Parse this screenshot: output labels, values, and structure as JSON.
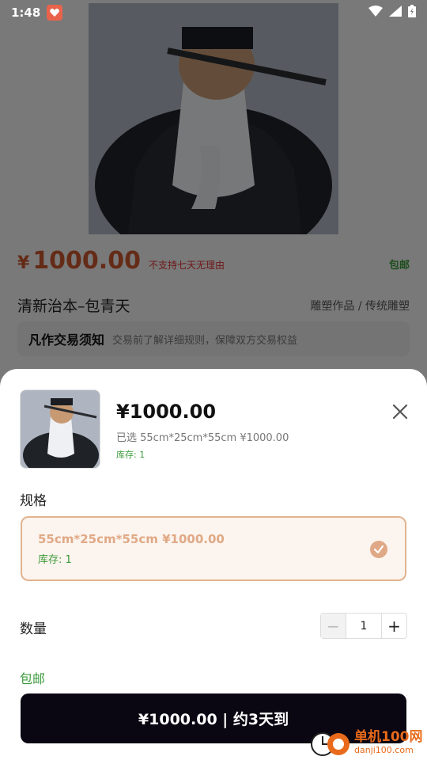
{
  "status_bar": {
    "time": "1:48"
  },
  "product_page": {
    "currency": "¥",
    "price": "1000.00",
    "no_return": "不支持七天无理由",
    "free_shipping": "包邮",
    "title": "清新治本–包青天",
    "category": "雕塑作品 / 传统雕塑",
    "notice_title": "凡作交易须知",
    "notice_text": "交易前了解详细规则，保障双方交易权益"
  },
  "sheet": {
    "price": "¥1000.00",
    "selected": "已选 55cm*25cm*55cm ¥1000.00",
    "stock": "库存: 1",
    "spec_label": "规格",
    "spec_option": {
      "name": "55cm*25cm*55cm ¥1000.00",
      "stock": "库存: 1"
    },
    "qty_label": "数量",
    "quantity": "1",
    "shipping": "包邮",
    "buy_button": "¥1000.00 | 约3天到"
  },
  "watermark": {
    "cn": "单机100网",
    "en": "danji100.com"
  },
  "colors": {
    "accent_green": "#3a9a3a",
    "price_red": "#c9562f",
    "spec_border": "#e2b38f",
    "buy_bg": "#0a0612"
  }
}
